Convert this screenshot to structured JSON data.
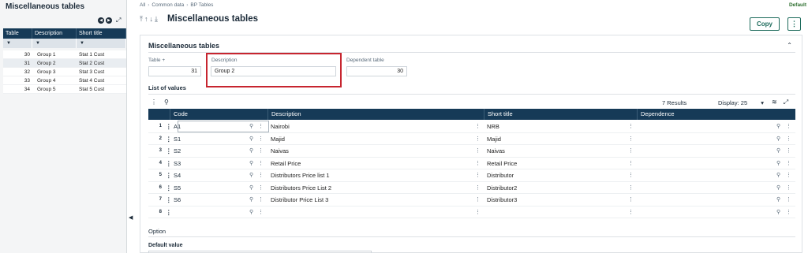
{
  "left_panel": {
    "title": "Miscellaneous tables",
    "columns": [
      "Table",
      "Description",
      "Short title"
    ],
    "rows": [
      {
        "table": "30",
        "description": "Group 1",
        "short_title": "Stat 1 Cust"
      },
      {
        "table": "31",
        "description": "Group 2",
        "short_title": "Stat 2 Cust"
      },
      {
        "table": "32",
        "description": "Group 3",
        "short_title": "Stat 3 Cust"
      },
      {
        "table": "33",
        "description": "Group 4",
        "short_title": "Stat 4 Cust"
      },
      {
        "table": "34",
        "description": "Group 5",
        "short_title": "Stat 5 Cust"
      }
    ],
    "selected_row": 1
  },
  "breadcrumb": [
    "All",
    "Common data",
    "BP Tables"
  ],
  "status": "Default",
  "page_title": "Miscellaneous tables",
  "buttons": {
    "copy": "Copy",
    "more": "⋮"
  },
  "section": {
    "title": "Miscellaneous tables",
    "fields": {
      "table_label": "Table +",
      "table_value": "31",
      "description_label": "Description",
      "description_value": "Group 2",
      "dependent_label": "Dependent table",
      "dependent_value": "30"
    }
  },
  "list": {
    "title": "List of values",
    "results": "7 Results",
    "display_label": "Display:",
    "display_value": "25",
    "columns": [
      "Code",
      "Description",
      "Short title",
      "Dependence"
    ],
    "rows": [
      {
        "n": "1",
        "code": "A1",
        "description": "Nairobi",
        "short_title": "NRB"
      },
      {
        "n": "2",
        "code": "S1",
        "description": "Majid",
        "short_title": "Majid"
      },
      {
        "n": "3",
        "code": "S2",
        "description": "Naivas",
        "short_title": "Naivas"
      },
      {
        "n": "4",
        "code": "S3",
        "description": "Retail Price",
        "short_title": "Retail Price"
      },
      {
        "n": "5",
        "code": "S4",
        "description": "Distributors Price list 1",
        "short_title": "Distributor"
      },
      {
        "n": "6",
        "code": "S5",
        "description": "Distributors Price List 2",
        "short_title": "Distributor2"
      },
      {
        "n": "7",
        "code": "S6",
        "description": "Distributor Price List 3",
        "short_title": "Distributor3"
      },
      {
        "n": "8",
        "code": "",
        "description": "",
        "short_title": ""
      }
    ]
  },
  "option": {
    "title": "Option",
    "default_value_label": "Default value"
  },
  "colors": {
    "header_bg": "#163a57",
    "accent": "#1d6b5c",
    "highlight": "#c7252f"
  }
}
